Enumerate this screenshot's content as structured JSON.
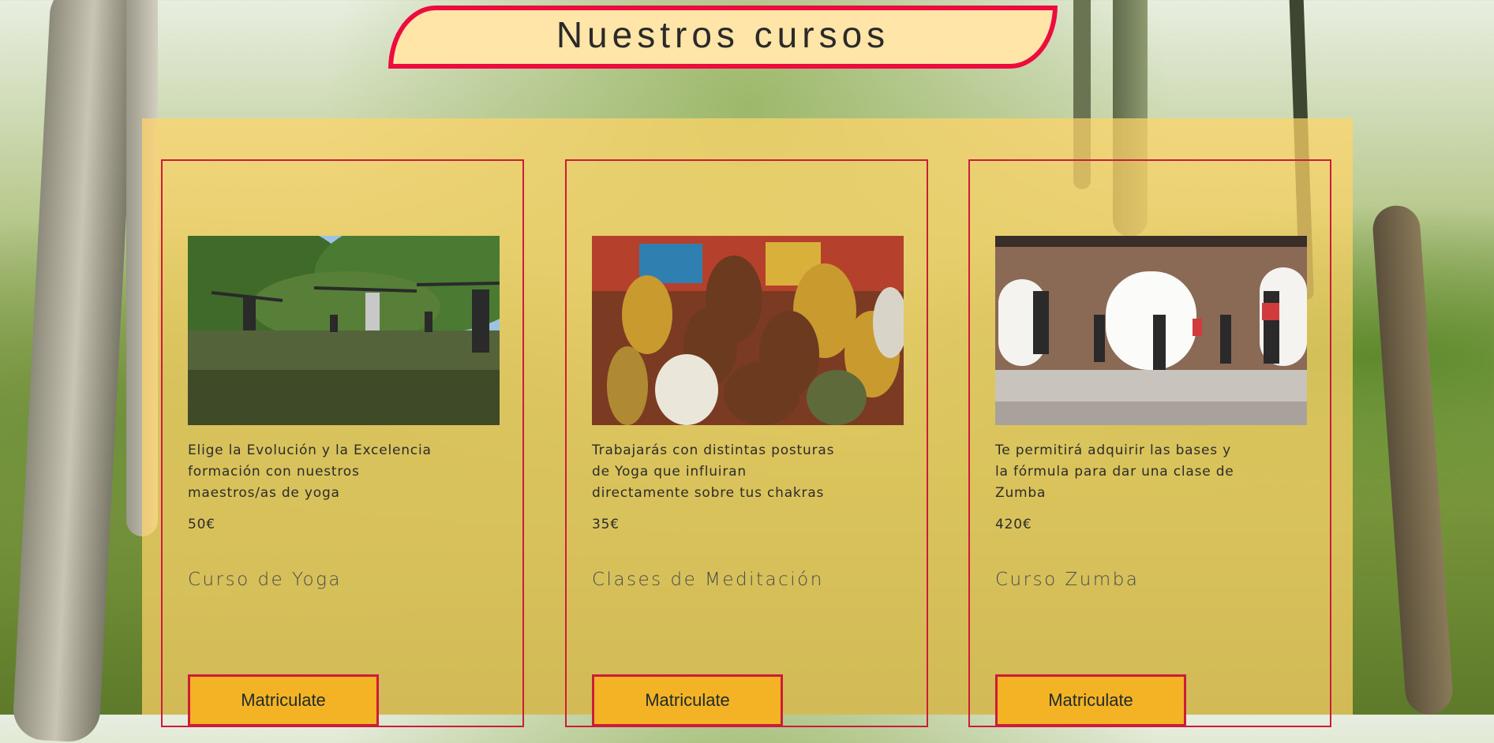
{
  "page": {
    "title": "Nuestros cursos"
  },
  "courses": [
    {
      "image_icon": "yoga-class-photo",
      "description": "Elige la Evolución y la Excelencia formación con nuestros maestros/as de yoga",
      "price": "50€",
      "name": "Curso de Yoga",
      "button_label": "Matriculate"
    },
    {
      "image_icon": "buddha-statues-photo",
      "description": "Trabajarás con distintas posturas de Yoga que influiran directamente sobre tus chakras",
      "price": "35€",
      "name": "Clases de Meditación",
      "button_label": "Matriculate"
    },
    {
      "image_icon": "zumba-class-photo",
      "description": "Te permitirá adquirir las bases y la fórmula para dar una clase de Zumba",
      "price": "420€",
      "name": "Curso Zumba",
      "button_label": "Matriculate"
    }
  ],
  "colors": {
    "accent_red": "#ee0c3f",
    "panel_yellow": "#ffd468",
    "button_yellow": "#f3b324",
    "banner_fill": "#ffe6a8"
  }
}
